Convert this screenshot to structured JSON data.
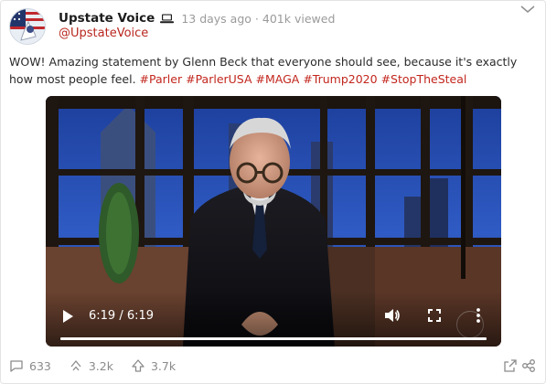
{
  "post": {
    "author_name": "Upstate Voice",
    "handle": "@UpstateVoice",
    "timestamp": "13 days ago",
    "separator": "·",
    "views": "401k viewed",
    "text": "WOW! Amazing statement by Glenn Beck that everyone should see, because it's exactly how most people feel.",
    "hashtags": [
      "#Parler",
      "#ParlerUSA",
      "#MAGA",
      "#Trump2020",
      "#StopTheSteal"
    ]
  },
  "video": {
    "time_display": "6:19 / 6:19",
    "progress": 1.0
  },
  "footer": {
    "comments": "633",
    "echoes": "3.2k",
    "upvotes": "3.7k"
  },
  "icons": {
    "author_badge": "laptop-icon",
    "menu": "chevron-down-icon",
    "play": "play-icon",
    "volume": "volume-icon",
    "fullscreen": "fullscreen-icon",
    "more": "more-vertical-icon",
    "comment": "comment-icon",
    "echo": "echo-icon",
    "upvote": "upvote-icon",
    "share": "share-icon"
  },
  "colors": {
    "hashtag": "#c2261d",
    "handle": "#b9271f",
    "meta": "#9a9a9a"
  }
}
